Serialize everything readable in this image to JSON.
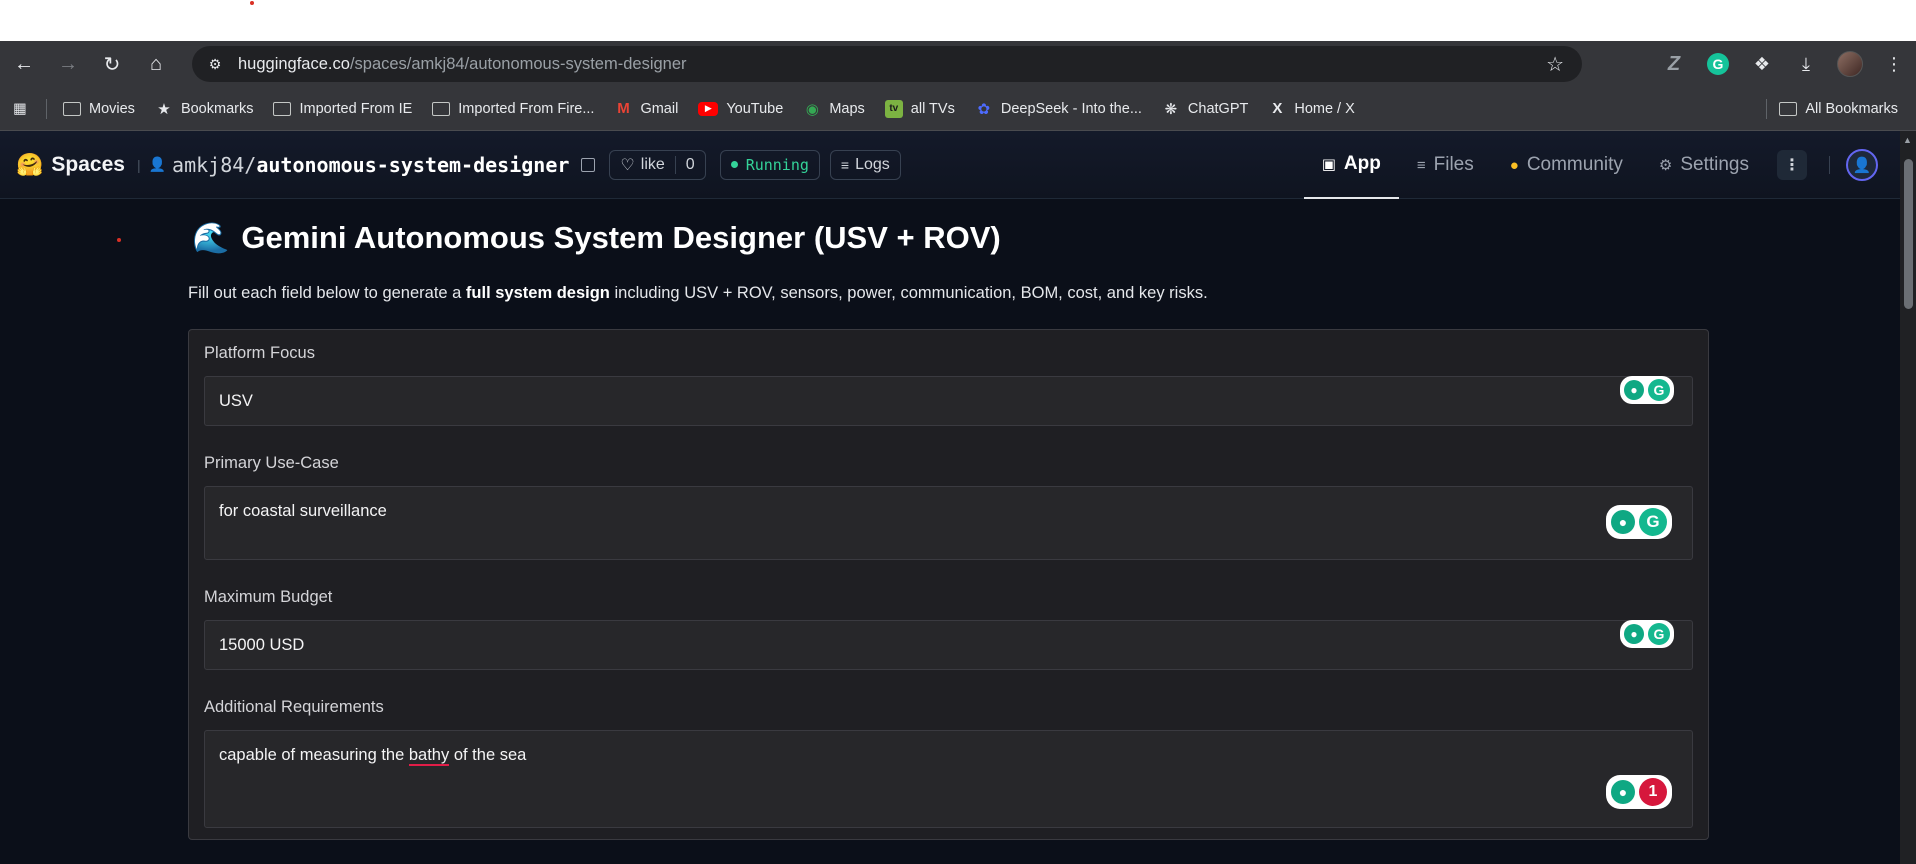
{
  "browser": {
    "url_host": "huggingface.co",
    "url_path": "/spaces/amkj84/autonomous-system-designer"
  },
  "bookmarks": [
    {
      "label": "Movies",
      "icon": "folder-icon"
    },
    {
      "label": "Bookmarks",
      "icon": "star-icon"
    },
    {
      "label": "Imported From IE",
      "icon": "folder-icon"
    },
    {
      "label": "Imported From Fire...",
      "icon": "folder-icon"
    },
    {
      "label": "Gmail",
      "icon": "gmail-icon"
    },
    {
      "label": "YouTube",
      "icon": "youtube-icon"
    },
    {
      "label": "Maps",
      "icon": "maps-icon"
    },
    {
      "label": "all TVs",
      "icon": "tv-icon"
    },
    {
      "label": "DeepSeek - Into the...",
      "icon": "deepseek-icon"
    },
    {
      "label": "ChatGPT",
      "icon": "chatgpt-icon"
    },
    {
      "label": "Home / X",
      "icon": "x-icon"
    }
  ],
  "all_bookmarks_label": "All Bookmarks",
  "hf": {
    "spaces_label": "Spaces",
    "owner": "amkj84",
    "slash": "/",
    "repo_name": "autonomous-system-designer",
    "like_label": "like",
    "like_count": "0",
    "status": "Running",
    "logs_label": "Logs",
    "tabs": [
      {
        "label": "App",
        "icon": "app-cube-icon",
        "active": true
      },
      {
        "label": "Files",
        "icon": "files-icon",
        "active": false
      },
      {
        "label": "Community",
        "icon": "community-icon",
        "active": false
      },
      {
        "label": "Settings",
        "icon": "gear-icon",
        "active": false
      }
    ]
  },
  "app": {
    "title": "Gemini Autonomous System Designer (USV + ROV)",
    "desc_before": "Fill out each field below to generate a ",
    "desc_bold": "full system design",
    "desc_after": " including USV + ROV, sensors, power, communication, BOM, cost, and key risks.",
    "fields": [
      {
        "label": "Platform Focus",
        "value": "USV"
      },
      {
        "label": "Primary Use-Case",
        "value": "for coastal surveillance"
      },
      {
        "label": "Maximum Budget",
        "value": "15000 USD"
      },
      {
        "label": "Additional Requirements",
        "value_before": "capable of measuring the ",
        "value_misspelled": "bathy",
        "value_after": " of the sea"
      }
    ],
    "grammarly_error_count": "1"
  },
  "colors": {
    "page_bg": "#0b0f19",
    "running_green": "#34d399",
    "grammarly_green": "#14b88f",
    "grammarly_error_red": "#d6173c"
  }
}
